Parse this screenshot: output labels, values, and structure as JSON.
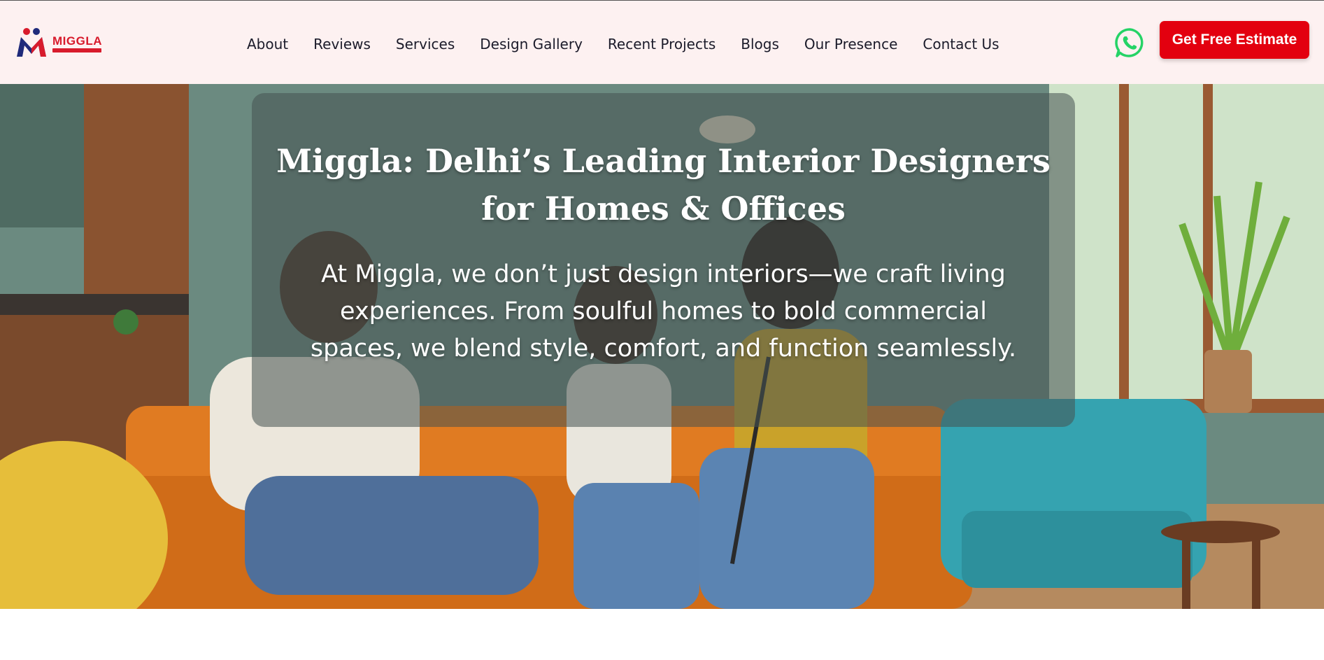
{
  "brand": {
    "name": "MIGGLA"
  },
  "nav": {
    "items": [
      "About",
      "Reviews",
      "Services",
      "Design Gallery",
      "Recent Projects",
      "Blogs",
      "Our Presence",
      "Contact Us"
    ]
  },
  "header": {
    "cta_label": "Get Free Estimate"
  },
  "hero": {
    "title_line1": "Miggla: Delhi’s Leading Interior Designers",
    "title_line2": "for Homes & Offices",
    "subtitle_line1": "At Miggla, we don’t just design interiors—we craft living",
    "subtitle_line2": "experiences. From soulful homes to bold commercial",
    "subtitle_line3": "spaces, we blend style, comfort, and function seamlessly."
  },
  "colors": {
    "header_bg": "#fdf1f1",
    "cta_bg": "#e3000f",
    "brand_red": "#d81b2c",
    "brand_navy": "#1f2a7a",
    "whatsapp_green": "#25d366"
  },
  "icons": {
    "whatsapp": "whatsapp-icon",
    "logo": "miggla-logo-icon"
  }
}
